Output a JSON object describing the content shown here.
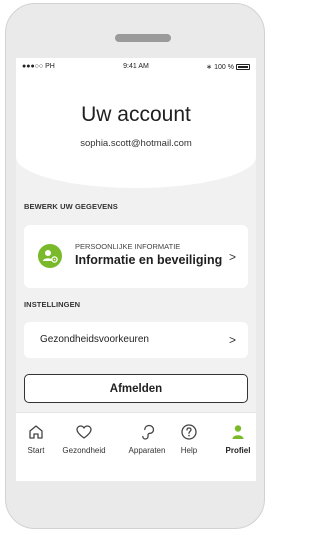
{
  "status_bar": {
    "carrier": "●●●○○ PH",
    "time": "9:41 AM",
    "battery": "100 %"
  },
  "header": {
    "title": "Uw account",
    "email": "sophia.scott@hotmail.com"
  },
  "section_profile": {
    "label": "BEWERK UW GEGEVENS"
  },
  "profile_card": {
    "overline": "PERSOONLIJKE INFORMATIE",
    "title": "Informatie en beveiliging",
    "icon": "user-gear-icon",
    "accent": "#7ab929"
  },
  "section_settings": {
    "label": "INSTELLINGEN"
  },
  "health_item": {
    "label": "Gezondheidsvoorkeuren"
  },
  "logout_button": {
    "label": "Afmelden"
  },
  "tab_bar": {
    "items": [
      {
        "label": "Start",
        "icon": "home-icon",
        "active": false
      },
      {
        "label": "Gezondheid",
        "icon": "heart-icon",
        "active": false
      },
      {
        "label": "Apparaten",
        "icon": "hearing-aid-icon",
        "active": false
      },
      {
        "label": "Help",
        "icon": "help-icon",
        "active": false
      },
      {
        "label": "Profiel",
        "icon": "person-icon",
        "active": true
      }
    ]
  }
}
